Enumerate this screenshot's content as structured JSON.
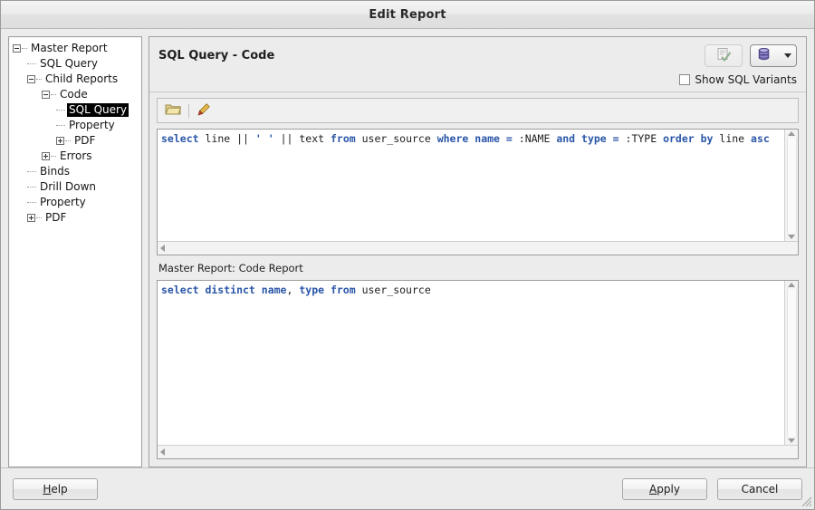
{
  "window": {
    "title": "Edit Report"
  },
  "tree": {
    "name": "report-structure-tree",
    "nodes": [
      {
        "label": "Master Report",
        "depth": 0,
        "toggle": "minus",
        "selected": false
      },
      {
        "label": "SQL Query",
        "depth": 1,
        "toggle": "none",
        "selected": false
      },
      {
        "label": "Child Reports",
        "depth": 1,
        "toggle": "minus",
        "selected": false
      },
      {
        "label": "Code",
        "depth": 2,
        "toggle": "minus",
        "selected": false
      },
      {
        "label": "SQL Query",
        "depth": 3,
        "toggle": "none",
        "selected": true
      },
      {
        "label": "Property",
        "depth": 3,
        "toggle": "none",
        "selected": false
      },
      {
        "label": "PDF",
        "depth": 3,
        "toggle": "plus",
        "selected": false
      },
      {
        "label": "Errors",
        "depth": 2,
        "toggle": "plus",
        "selected": false
      },
      {
        "label": "Binds",
        "depth": 1,
        "toggle": "none",
        "selected": false
      },
      {
        "label": "Drill Down",
        "depth": 1,
        "toggle": "none",
        "selected": false
      },
      {
        "label": "Property",
        "depth": 1,
        "toggle": "none",
        "selected": false
      },
      {
        "label": "PDF",
        "depth": 1,
        "toggle": "plus",
        "selected": false
      }
    ]
  },
  "panel": {
    "title": "SQL Query - Code",
    "validate_button_icon": "validate-document-icon",
    "database_button_icon": "database-icon",
    "checkbox": {
      "label": "Show SQL Variants",
      "checked": false
    }
  },
  "editor_toolbar": {
    "open_icon": "open-folder-icon",
    "edit_icon": "pencil-icon"
  },
  "primary_editor": {
    "name": "sql-query-editor",
    "text": "select line || ' ' || text from user_source where name = :NAME and type = :TYPE order by line asc",
    "tokens": [
      {
        "t": "select",
        "k": true
      },
      {
        "t": " line ",
        "k": false
      },
      {
        "t": "|| ",
        "k": false
      },
      {
        "t": "' '",
        "k": true
      },
      {
        "t": " || ",
        "k": false
      },
      {
        "t": "text ",
        "k": false
      },
      {
        "t": "from",
        "k": true
      },
      {
        "t": " user_source ",
        "k": false
      },
      {
        "t": "where",
        "k": true
      },
      {
        "t": " ",
        "k": false
      },
      {
        "t": "name",
        "k": true
      },
      {
        "t": " ",
        "k": false
      },
      {
        "t": "=",
        "k": true
      },
      {
        "t": " :NAME ",
        "k": false
      },
      {
        "t": "and",
        "k": true
      },
      {
        "t": " ",
        "k": false
      },
      {
        "t": "type",
        "k": true
      },
      {
        "t": " ",
        "k": false
      },
      {
        "t": "=",
        "k": true
      },
      {
        "t": " :TYPE ",
        "k": false
      },
      {
        "t": "order by",
        "k": true
      },
      {
        "t": " line ",
        "k": false
      },
      {
        "t": "asc",
        "k": true
      }
    ]
  },
  "secondary_editor": {
    "name": "bind-sql-editor",
    "caption": "Master Report:  Code Report",
    "text": "select distinct name, type from user_source",
    "tokens": [
      {
        "t": "select distinct name",
        "k": true
      },
      {
        "t": ", ",
        "k": false
      },
      {
        "t": "type from",
        "k": true
      },
      {
        "t": " user_source",
        "k": false
      }
    ]
  },
  "footer": {
    "help": {
      "label": "Help",
      "mnemonic": "H"
    },
    "apply": {
      "label": "Apply",
      "mnemonic": "A"
    },
    "cancel": {
      "label": "Cancel",
      "mnemonic": ""
    }
  },
  "colors": {
    "keyword": "#2a56a8",
    "selection_bg": "#000000",
    "selection_fg": "#ffffff",
    "window_bg": "#ececec",
    "editor_bg": "#ffffff"
  }
}
